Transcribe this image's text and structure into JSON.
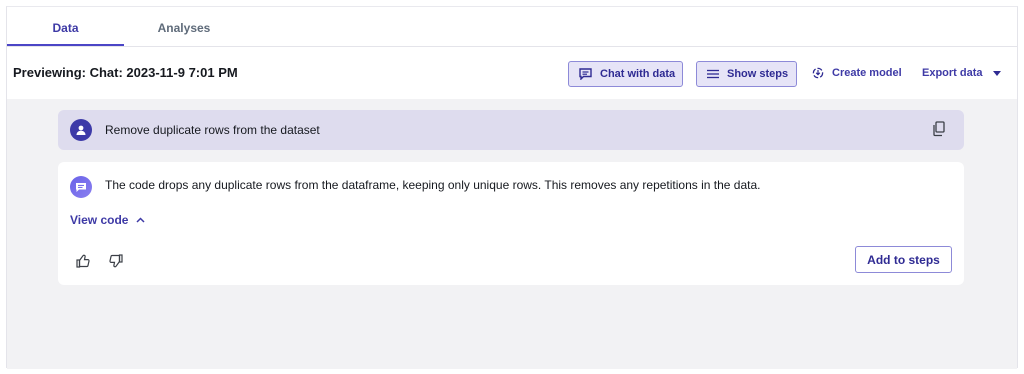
{
  "tabs": [
    {
      "label": "Data",
      "active": true
    },
    {
      "label": "Analyses",
      "active": false
    }
  ],
  "toolbar": {
    "preview_title": "Previewing: Chat: 2023-11-9 7:01 PM",
    "chat_with_data_label": "Chat with data",
    "show_steps_label": "Show steps",
    "create_model_label": "Create model",
    "export_data_label": "Export data"
  },
  "chat": {
    "user_message": "Remove duplicate rows from the dataset",
    "reply_text": "The code drops any duplicate rows from the dataframe, keeping only unique rows. This removes any repetitions in the data.",
    "view_code_label": "View code",
    "add_to_steps_label": "Add to steps"
  },
  "icons": {
    "chat": "chat-bubble-icon",
    "steps": "list-icon",
    "model": "model-icon",
    "caret": "caret-down-icon",
    "avatar": "user-icon",
    "copy": "copy-icon",
    "bot": "bot-chat-icon",
    "chevron": "chevron-up-icon",
    "thumbs_up": "thumbs-up-icon",
    "thumbs_down": "thumbs-down-icon"
  },
  "colors": {
    "accent": "#3e3aa6",
    "button_bg": "#e6e4f7",
    "user_bubble": "#dedcee",
    "panel_bg": "#f2f2f4"
  }
}
